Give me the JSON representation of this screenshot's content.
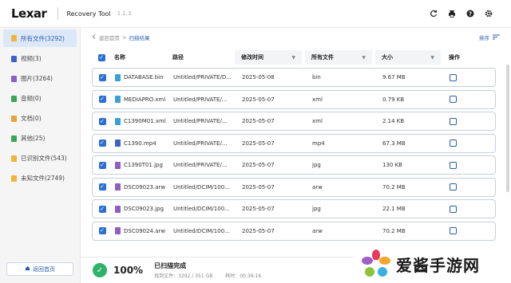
{
  "app": {
    "logo": "Lexar",
    "title": "Recovery Tool",
    "version": "1.1.3"
  },
  "title_icons": [
    "refresh-icon",
    "print-icon",
    "help-icon",
    "settings-icon"
  ],
  "sidebar": {
    "items": [
      {
        "label": "所有文件(3292)",
        "icon": "folder-icon",
        "color": "#f0b43c",
        "active": true
      },
      {
        "label": "视频(3)",
        "icon": "video-icon",
        "color": "#3a62c9"
      },
      {
        "label": "图片(3264)",
        "icon": "image-icon",
        "color": "#8e5ec4"
      },
      {
        "label": "音频(0)",
        "icon": "audio-icon",
        "color": "#3aa65a"
      },
      {
        "label": "文档(0)",
        "icon": "document-icon",
        "color": "#e8a43a"
      },
      {
        "label": "其他(25)",
        "icon": "other-icon",
        "color": "#3aa65a"
      },
      {
        "label": "已识别文件(543)",
        "icon": "folder-icon",
        "color": "#f0b43c"
      },
      {
        "label": "未知文件(2749)",
        "icon": "folder-icon",
        "color": "#f0b43c"
      }
    ],
    "home_label": "返回首页"
  },
  "breadcrumb": {
    "back": "返回首页",
    "sep": ">",
    "current": "扫描结果"
  },
  "sort_label": "排序",
  "table": {
    "headers": {
      "name": "名称",
      "path": "路径",
      "date": "修改时间",
      "type": "所有文件",
      "size": "大小",
      "action": "操作"
    },
    "rows": [
      {
        "name": "DATABASE.bin",
        "path": "Untitled/PRIVATE/D...",
        "date": "2025-05-08",
        "type": "bin",
        "size": "9.67 MB",
        "icon_color": "#3aa0d8"
      },
      {
        "name": "MEDIAPRO.xml",
        "path": "Untitled/PRIVATE/...",
        "date": "2025-05-07",
        "type": "xml",
        "size": "0.79 KB",
        "icon_color": "#3aa0d8"
      },
      {
        "name": "C1390M01.xml",
        "path": "Untitled/PRIVATE/...",
        "date": "2025-05-07",
        "type": "xml",
        "size": "2.14 KB",
        "icon_color": "#3aa0d8"
      },
      {
        "name": "C1390.mp4",
        "path": "Untitled/PRIVATE/...",
        "date": "2025-05-07",
        "type": "mp4",
        "size": "67.3 MB",
        "icon_color": "#3a62c9"
      },
      {
        "name": "C1390T01.jpg",
        "path": "Untitled/PRIVATE/...",
        "date": "2025-05-07",
        "type": "jpg",
        "size": "130 KB",
        "icon_color": "#8e5ec4"
      },
      {
        "name": "DSC09023.arw",
        "path": "Untitled/DCIM/100...",
        "date": "2025-05-07",
        "type": "arw",
        "size": "70.2 MB",
        "icon_color": "#8e5ec4"
      },
      {
        "name": "DSC09023.jpg",
        "path": "Untitled/DCIM/100...",
        "date": "2025-05-07",
        "type": "jpg",
        "size": "22.1 MB",
        "icon_color": "#8e5ec4"
      },
      {
        "name": "DSC09024.arw",
        "path": "Untitled/DCIM/100...",
        "date": "2025-05-07",
        "type": "arw",
        "size": "70.2 MB",
        "icon_color": "#8e5ec4"
      }
    ]
  },
  "status": {
    "percent": "100%",
    "title": "已扫描完成",
    "found": "找到文件：3292 / 351 GB",
    "elapsed": "耗时：00:36:16"
  },
  "watermark": {
    "text": "爱酱手游网"
  },
  "colors": {
    "accent": "#2a5db0",
    "checkbox": "#2a6fd6",
    "success": "#2fb36a",
    "sidebar_active": "#dce8f8"
  }
}
